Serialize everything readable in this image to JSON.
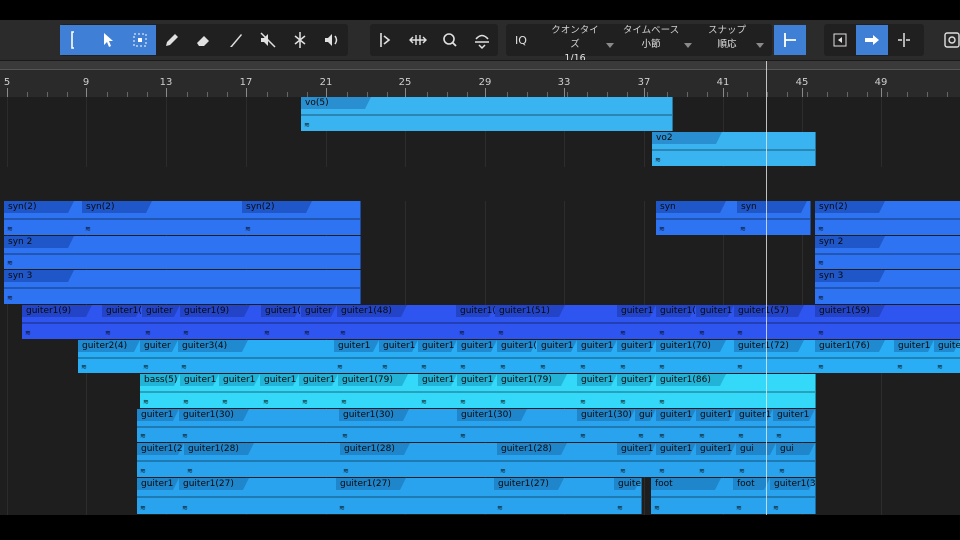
{
  "toolbar": {
    "tools": [
      {
        "name": "range-select-icon",
        "active": true
      },
      {
        "name": "arrow-pointer-icon",
        "active": true
      },
      {
        "name": "marquee-select-icon",
        "active": true
      },
      {
        "name": "pencil-icon",
        "active": false
      },
      {
        "name": "eraser-icon",
        "active": false
      },
      {
        "name": "paint-brush-icon",
        "active": false
      },
      {
        "name": "mute-icon",
        "active": false
      },
      {
        "name": "split-scissors-icon",
        "active": false
      },
      {
        "name": "speaker-icon",
        "active": false
      }
    ],
    "edit_tools": [
      "bend-marker-icon",
      "time-stretch-icon",
      "zoom-icon",
      "listen-icon"
    ],
    "iq_label": "IQ",
    "quantize": {
      "label": "クオンタイズ",
      "value": "1/16"
    },
    "timebase": {
      "label": "タイムベース",
      "value": "小節"
    },
    "snap": {
      "label": "スナップ",
      "value": "順応"
    },
    "right_tools": [
      {
        "name": "snap-to-grid-icon",
        "active": true
      },
      {
        "name": "follow-left-icon",
        "active": false
      },
      {
        "name": "follow-right-icon",
        "active": true
      },
      {
        "name": "cursor-split-icon",
        "active": false
      },
      {
        "name": "zoom-fit-icon",
        "active": false
      }
    ]
  },
  "ruler": {
    "bars": [
      "5",
      "9",
      "13",
      "17",
      "21",
      "25",
      "29",
      "33",
      "37",
      "41",
      "45",
      "49"
    ]
  },
  "colors": {
    "vocal": "#39b4f0",
    "vocal_header": "#2a8fd0",
    "synth": "#2d73f2",
    "synth_header": "#1f56c8",
    "guitar1": "#2e55f0",
    "guitar2": "#29aef5",
    "bass": "#34d8f8",
    "guitar_low": "#29a3ee"
  },
  "lanes": [
    {
      "name": "vocal-lane-1",
      "clips": [
        {
          "label": "vo(5)"
        }
      ]
    },
    {
      "name": "vocal-lane-2",
      "clips": [
        {
          "label": "vo2"
        }
      ]
    },
    {
      "name": "synth-lane-1",
      "clips": [
        {
          "label": "syn(2)"
        },
        {
          "label": "syn(2)"
        },
        {
          "label": "syn(2)"
        },
        {
          "label": "syn"
        },
        {
          "label": "syn"
        },
        {
          "label": "syn(2)"
        }
      ]
    },
    {
      "name": "synth-lane-2",
      "clips": [
        {
          "label": "syn 2"
        },
        {
          "label": "syn 2"
        }
      ]
    },
    {
      "name": "synth-lane-3",
      "clips": [
        {
          "label": "syn 3"
        },
        {
          "label": "syn 3"
        }
      ]
    },
    {
      "name": "guitar1-lane",
      "clips": [
        {
          "label": "guiter1(9)"
        },
        {
          "label": "guiter1("
        },
        {
          "label": "guiter"
        },
        {
          "label": "guiter1(9)"
        },
        {
          "label": "guiter1("
        },
        {
          "label": "guiter"
        },
        {
          "label": "guiter1(48)"
        },
        {
          "label": "guiter1("
        },
        {
          "label": "guiter1(51)"
        },
        {
          "label": "guiter1"
        },
        {
          "label": "guiter1("
        },
        {
          "label": "guiter1"
        },
        {
          "label": "guiter1(57)"
        },
        {
          "label": "guiter1(59)"
        }
      ]
    },
    {
      "name": "guitar2-lane",
      "clips": [
        {
          "label": "guiter2(4)"
        },
        {
          "label": "guiter"
        },
        {
          "label": "guiter3(4)"
        },
        {
          "label": "guiter1"
        },
        {
          "label": "guiter1"
        },
        {
          "label": "guiter1"
        },
        {
          "label": "guiter1"
        },
        {
          "label": "guiter1("
        },
        {
          "label": "guiter1"
        },
        {
          "label": "guiter1"
        },
        {
          "label": "guiter1"
        },
        {
          "label": "guiter1(70)"
        },
        {
          "label": "guiter1(72)"
        },
        {
          "label": "guiter1(76)"
        },
        {
          "label": "guiter1"
        },
        {
          "label": "guiter1"
        }
      ]
    },
    {
      "name": "bass-lane",
      "clips": [
        {
          "label": "bass(5)"
        },
        {
          "label": "guiter1"
        },
        {
          "label": "guiter1"
        },
        {
          "label": "guiter1"
        },
        {
          "label": "guiter1"
        },
        {
          "label": "guiter1(79)"
        },
        {
          "label": "guiter1"
        },
        {
          "label": "guiter1"
        },
        {
          "label": "guiter1(79)"
        },
        {
          "label": "guiter1"
        },
        {
          "label": "guiter1"
        },
        {
          "label": "guiter1(86)"
        }
      ]
    },
    {
      "name": "guitar-lane-9",
      "clips": [
        {
          "label": "guiter1"
        },
        {
          "label": "guiter1(30)"
        },
        {
          "label": "guiter1(30)"
        },
        {
          "label": "guiter1(30)"
        },
        {
          "label": "guiter1(30)"
        },
        {
          "label": "gui"
        },
        {
          "label": "guiter1"
        },
        {
          "label": "guiter1"
        },
        {
          "label": "guiter1"
        },
        {
          "label": "guiter1"
        }
      ]
    },
    {
      "name": "guitar-lane-10",
      "clips": [
        {
          "label": "guiter1(2"
        },
        {
          "label": "guiter1(28)"
        },
        {
          "label": "guiter1(28)"
        },
        {
          "label": "guiter1(28)"
        },
        {
          "label": "guiter1"
        },
        {
          "label": "guiter1"
        },
        {
          "label": "guiter1"
        },
        {
          "label": "gui"
        },
        {
          "label": "gui"
        }
      ]
    },
    {
      "name": "guitar-lane-11",
      "clips": [
        {
          "label": "guiter1"
        },
        {
          "label": "guiter1(27)"
        },
        {
          "label": "guiter1(27)"
        },
        {
          "label": "guiter1(27)"
        },
        {
          "label": "guite"
        },
        {
          "label": "foot"
        },
        {
          "label": "foot"
        },
        {
          "label": "guiter1(3"
        }
      ]
    }
  ],
  "fx_glyph": "≋"
}
